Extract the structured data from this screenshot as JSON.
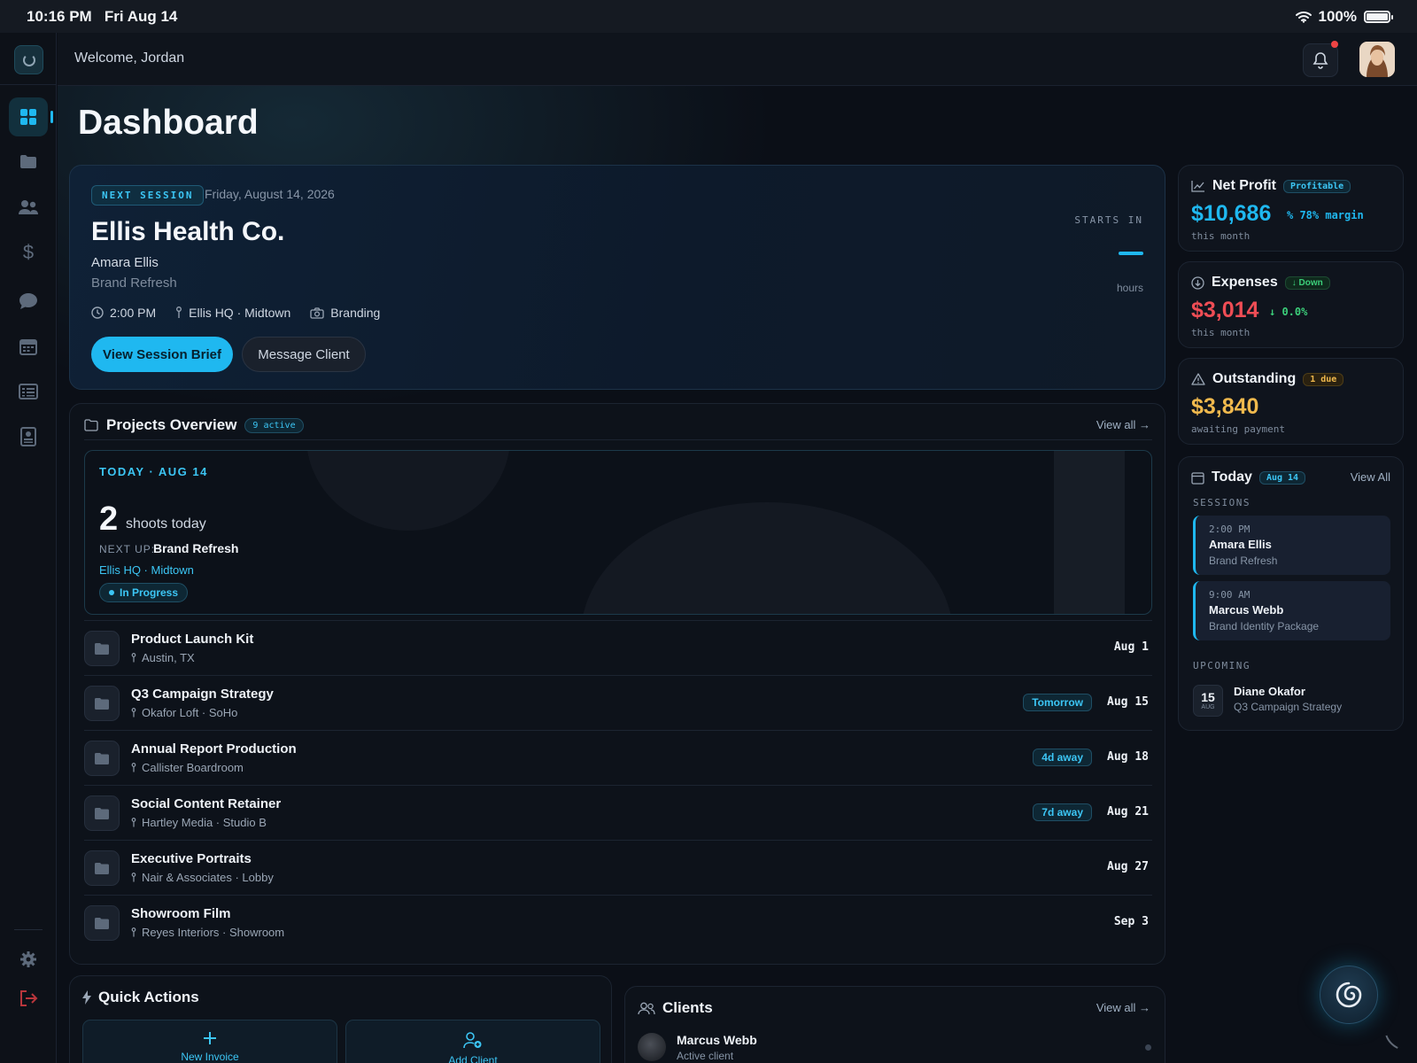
{
  "status_bar": {
    "time": "10:16 PM",
    "date": "Fri Aug 14",
    "battery": "100%",
    "battery_level": 1.0
  },
  "header": {
    "welcome": "Welcome, Jordan"
  },
  "sidebar": {
    "items": [
      {
        "name": "dashboard",
        "icon": "grid-icon",
        "active": true
      },
      {
        "name": "projects",
        "icon": "folder-icon"
      },
      {
        "name": "clients",
        "icon": "users-icon"
      },
      {
        "name": "finance",
        "icon": "dollar-icon"
      },
      {
        "name": "messages",
        "icon": "chat-icon"
      },
      {
        "name": "calendar",
        "icon": "calendar-icon"
      },
      {
        "name": "reports",
        "icon": "list-icon"
      },
      {
        "name": "contacts",
        "icon": "contact-card-icon"
      }
    ],
    "bottom": [
      {
        "name": "settings",
        "icon": "gear-icon"
      },
      {
        "name": "logout",
        "icon": "logout-icon"
      }
    ]
  },
  "page": {
    "title": "Dashboard"
  },
  "next_session": {
    "tag": "NEXT SESSION",
    "date": "Friday, August 14, 2026",
    "client": "Ellis Health Co.",
    "contact": "Amara Ellis",
    "project": "Brand Refresh",
    "time": "2:00 PM",
    "location": "Ellis HQ · Midtown",
    "category": "Branding",
    "primary_button": "View Session Brief",
    "secondary_button": "Message Client",
    "starts_in_label": "STARTS IN",
    "starts_in_unit": "hours"
  },
  "projects": {
    "title": "Projects Overview",
    "count": "9 active",
    "view_all": "View all →",
    "today": {
      "label": "TODAY · AUG 14",
      "count": "2",
      "count_text": "shoots today",
      "next_up_label": "NEXT UP:",
      "next_up": "Brand Refresh",
      "location": "Ellis HQ · Midtown",
      "status": "In Progress"
    },
    "rows": [
      {
        "name": "Product Launch Kit",
        "location": "Austin, TX",
        "badge": "",
        "date": "Aug 1"
      },
      {
        "name": "Q3 Campaign Strategy",
        "location": "Okafor Loft · SoHo",
        "badge": "Tomorrow",
        "date": "Aug 15"
      },
      {
        "name": "Annual Report Production",
        "location": "Callister Boardroom",
        "badge": "4d away",
        "date": "Aug 18"
      },
      {
        "name": "Social Content Retainer",
        "location": "Hartley Media · Studio B",
        "badge": "7d away",
        "date": "Aug 21"
      },
      {
        "name": "Executive Portraits",
        "location": "Nair & Associates · Lobby",
        "badge": "",
        "date": "Aug 27"
      },
      {
        "name": "Showroom Film",
        "location": "Reyes Interiors · Showroom",
        "badge": "",
        "date": "Sep 3"
      }
    ]
  },
  "quick_actions": {
    "title": "Quick Actions",
    "new_invoice": "New Invoice",
    "add_client": "Add Client"
  },
  "clients": {
    "title": "Clients",
    "view_all": "View all →",
    "first": {
      "name": "Marcus Webb",
      "status": "Active client"
    }
  },
  "stats": {
    "net_profit": {
      "title": "Net Profit",
      "badge": "Profitable",
      "value": "$10,686",
      "sub": "% 78% margin",
      "foot": "this month",
      "color": "#1fb8f0"
    },
    "expenses": {
      "title": "Expenses",
      "badge": "↓ Down",
      "value": "$3,014",
      "sub": "↓ 0.0%",
      "foot": "this month",
      "color": "#ef4d55"
    },
    "outstanding": {
      "title": "Outstanding",
      "badge": "1 due",
      "value": "$3,840",
      "foot": "awaiting payment",
      "color": "#f0b94d"
    }
  },
  "today_panel": {
    "title": "Today",
    "badge": "Aug 14",
    "view_all": "View All",
    "sessions_label": "SESSIONS",
    "sessions": [
      {
        "time": "2:00 PM",
        "name": "Amara Ellis",
        "project": "Brand Refresh"
      },
      {
        "time": "9:00 AM",
        "name": "Marcus Webb",
        "project": "Brand Identity Package"
      }
    ],
    "upcoming_label": "UPCOMING",
    "upcoming": {
      "day": "15",
      "month": "AUG",
      "name": "Diane Okafor",
      "project": "Q3 Campaign Strategy"
    }
  }
}
